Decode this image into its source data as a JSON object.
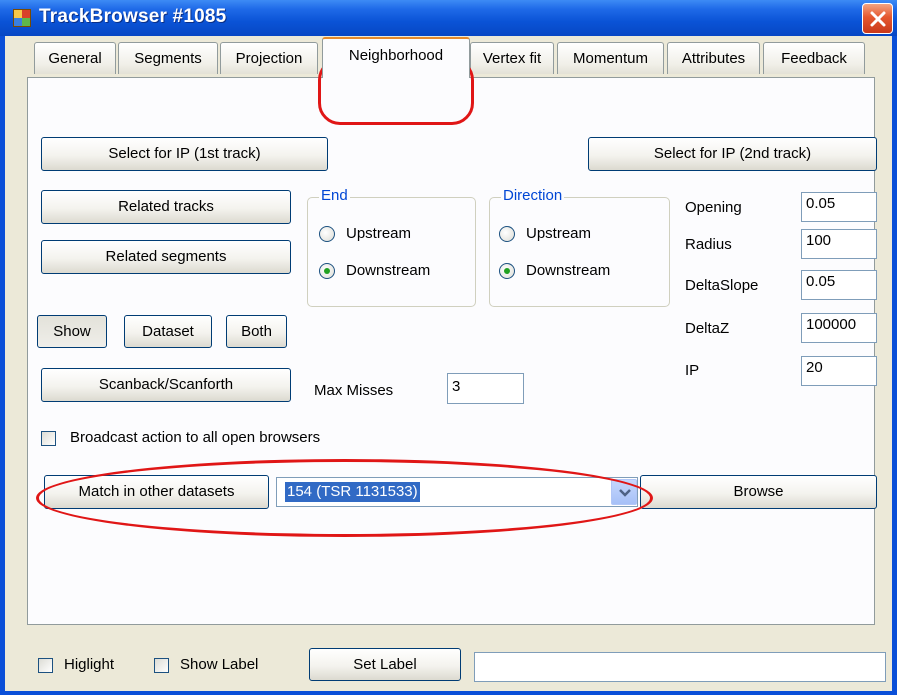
{
  "window": {
    "title": "TrackBrowser #1085"
  },
  "tabs": [
    "General",
    "Segments",
    "Projection",
    "Neighborhood",
    "Vertex fit",
    "Momentum",
    "Attributes",
    "Feedback"
  ],
  "active_tab": "Neighborhood",
  "neighborhood": {
    "select_ip_1": "Select for IP (1st track)",
    "select_ip_2": "Select for IP (2nd track)",
    "related_tracks": "Related tracks",
    "related_segments": "Related segments",
    "end_group": {
      "legend": "End",
      "upstream": "Upstream",
      "downstream": "Downstream",
      "selected": "Downstream"
    },
    "direction_group": {
      "legend": "Direction",
      "upstream": "Upstream",
      "downstream": "Downstream",
      "selected": "Downstream"
    },
    "params": [
      {
        "label": "Opening",
        "value": "0.05"
      },
      {
        "label": "Radius",
        "value": "100"
      },
      {
        "label": "DeltaSlope",
        "value": "0.05"
      },
      {
        "label": "DeltaZ",
        "value": "100000"
      },
      {
        "label": "IP",
        "value": "20"
      }
    ],
    "show": "Show",
    "dataset": "Dataset",
    "both": "Both",
    "scanback": "Scanback/Scanforth",
    "max_misses_label": "Max Misses",
    "max_misses_value": "3",
    "broadcast_label": "Broadcast action to all open browsers",
    "broadcast_checked": false,
    "match_button": "Match in other datasets",
    "dataset_select": "154 (TSR 1131533)",
    "browse_button": "Browse"
  },
  "footer": {
    "highlight_label": "Higlight",
    "highlight_checked": false,
    "show_label_label": "Show Label",
    "show_label_checked": false,
    "set_label_button": "Set Label",
    "label_input_value": ""
  },
  "colors": {
    "title_bar": "#0a53d6",
    "face": "#ece9d8",
    "annotation": "#e01616",
    "selection": "#316ac5",
    "legend": "#0046d5"
  }
}
